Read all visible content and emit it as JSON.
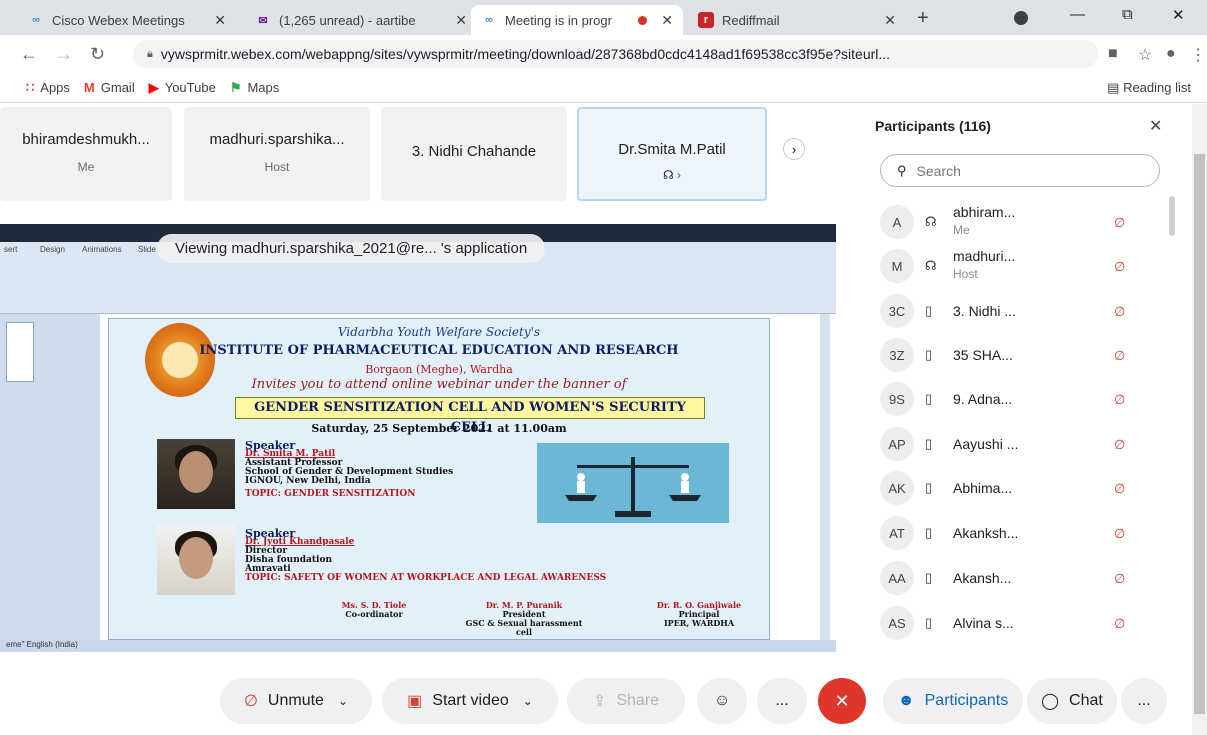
{
  "browser": {
    "tabs": [
      {
        "title": "Cisco Webex Meetings",
        "icon": "webex-icon",
        "active": false
      },
      {
        "title": "(1,265 unread) - aartibe",
        "icon": "mail-icon",
        "active": false
      },
      {
        "title": "Meeting is in progr",
        "icon": "webex-icon",
        "active": true,
        "recording": true
      },
      {
        "title": "Rediffmail",
        "icon": "rediff-icon",
        "active": false
      }
    ],
    "url": "vywsprmitr.webex.com/webappng/sites/vywsprmitr/meeting/download/287368bd0cdc4148ad1f69538cc3f95e?siteurl...",
    "bookmarks": [
      {
        "label": "Apps",
        "icon": "apps-grid-icon",
        "color": "#e94235"
      },
      {
        "label": "Gmail",
        "icon": "gmail-icon",
        "color": "#ea4335"
      },
      {
        "label": "YouTube",
        "icon": "youtube-icon",
        "color": "#ff0000"
      },
      {
        "label": "Maps",
        "icon": "maps-icon",
        "color": "#34a853"
      }
    ],
    "reading_list": "Reading list"
  },
  "meeting": {
    "tiles": [
      {
        "name": "bhiramdeshmukh...",
        "role": "Me"
      },
      {
        "name": "madhuri.sparshika...",
        "role": "Host"
      },
      {
        "name": "3. Nidhi Chahande",
        "role": ""
      },
      {
        "name": "Dr.Smita M.Patil",
        "role": ""
      }
    ],
    "share_banner": "Viewing madhuri.sparshika_2021@re... 's application",
    "slide": {
      "org": "Vidarbha Youth Welfare Society's",
      "institute": "INSTITUTE OF PHARMACEUTICAL EDUCATION AND RESEARCH",
      "location": "Borgaon (Meghe), Wardha",
      "invite": "Invites you to attend online webinar under the banner of",
      "cell": "GENDER SENSITIZATION CELL AND WOMEN'S SECURITY CELL",
      "date": "Saturday, 25 September 2021 at 11.00am",
      "speaker1": {
        "heading": "Speaker",
        "name": "Dr. Smita M. Patil",
        "line1": "Assistant Professor",
        "line2": "School of Gender & Development Studies",
        "line3": "IGNOU, New Delhi, India",
        "topic": "TOPIC: GENDER SENSITIZATION"
      },
      "speaker2": {
        "heading": "Speaker",
        "name": "Dr. Jyoti Khandpasale",
        "line1": "Director",
        "line2": "Disha foundation",
        "line3": "Amravati",
        "topic": "TOPIC: SAFETY OF WOMEN AT WORKPLACE AND LEGAL AWARENESS"
      },
      "signatories": [
        {
          "name": "Ms. S. D. Tiole",
          "role": "Co-ordinator",
          "extra": ""
        },
        {
          "name": "Dr. M. P. Puranik",
          "role": "President",
          "extra": "GSC & Sexual harassment cell"
        },
        {
          "name": "Dr. R. O. Ganjiwale",
          "role": "Principal",
          "extra": "IPER, WARDHA"
        }
      ]
    },
    "ppt_ribbon_tabs": [
      "sert",
      "Design",
      "Animations",
      "Slide"
    ],
    "ppt_status": "eme\"  English (India)"
  },
  "participants_panel": {
    "title": "Participants (116)",
    "search_placeholder": "Search",
    "list": [
      {
        "initials": "A",
        "name": "abhiram...",
        "sub": "Me",
        "device": "headset-icon"
      },
      {
        "initials": "M",
        "name": "madhuri...",
        "sub": "Host",
        "device": "headset-icon"
      },
      {
        "initials": "3C",
        "name": "3. Nidhi ...",
        "sub": "",
        "device": "mobile-icon"
      },
      {
        "initials": "3Z",
        "name": "35 SHA...",
        "sub": "",
        "device": "mobile-icon"
      },
      {
        "initials": "9S",
        "name": "9. Adna...",
        "sub": "",
        "device": "mobile-icon"
      },
      {
        "initials": "AP",
        "name": "Aayushi ...",
        "sub": "",
        "device": "mobile-icon"
      },
      {
        "initials": "AK",
        "name": "Abhima...",
        "sub": "",
        "device": "mobile-icon"
      },
      {
        "initials": "AT",
        "name": "Akanksh...",
        "sub": "",
        "device": "mobile-icon"
      },
      {
        "initials": "AA",
        "name": "Akansh...",
        "sub": "",
        "device": "mobile-icon"
      },
      {
        "initials": "AS",
        "name": "Alvina s...",
        "sub": "",
        "device": "mobile-icon"
      }
    ]
  },
  "controls": {
    "unmute": "Unmute",
    "start_video": "Start video",
    "share": "Share",
    "more": "...",
    "participants": "Participants",
    "chat": "Chat",
    "more2": "..."
  }
}
